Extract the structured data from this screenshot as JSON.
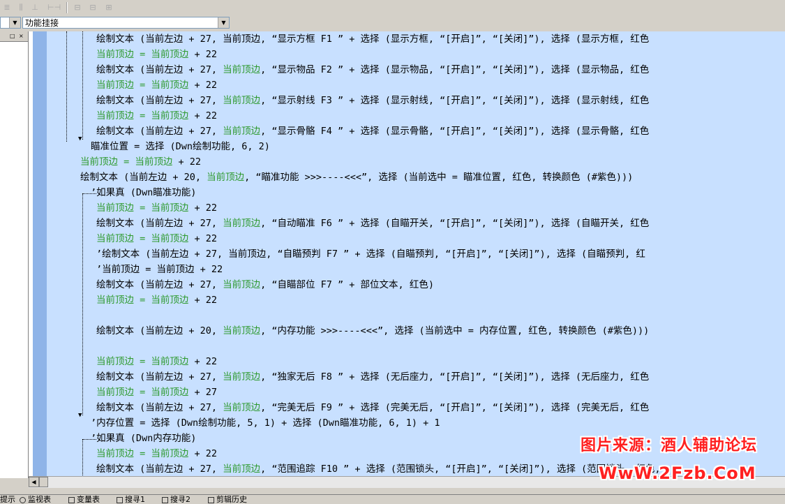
{
  "toolbar": {
    "buttons": [
      "align-top-icon",
      "align-vcenter-icon",
      "align-bottom-icon",
      "align-hspace-icon",
      "align-width-icon",
      "align-center-icon"
    ],
    "glyphs": [
      "≣",
      "⫼",
      "⊥",
      "⊢⊣",
      "⊟",
      "⊞"
    ]
  },
  "combos": {
    "left_value": "",
    "right_value": "功能挂接"
  },
  "left_panel": {
    "pin": "□",
    "close": "×"
  },
  "code_lines": [
    {
      "indent": 2,
      "segs": [
        [
          "绘制文本 (当前左边 + 27, ",
          ""
        ],
        [
          "当前顶边",
          ""
        ],
        [
          ", “显示方框 F1       ” + 选择 (显示方框, “[开启]”, “[关闭]”), 选择 (显示方框, 红色",
          ""
        ]
      ]
    },
    {
      "indent": 2,
      "segs": [
        [
          "当前顶边 = 当前顶边",
          "g"
        ],
        [
          " + 22",
          ""
        ]
      ]
    },
    {
      "indent": 2,
      "segs": [
        [
          "绘制文本 (当前左边 + 27, ",
          ""
        ],
        [
          "当前顶边",
          "g"
        ],
        [
          ", “显示物品 F2       ” + 选择 (显示物品, “[开启]”, “[关闭]”), 选择 (显示物品, 红色",
          ""
        ]
      ]
    },
    {
      "indent": 2,
      "segs": [
        [
          "当前顶边 = 当前顶边",
          "g"
        ],
        [
          " + 22",
          ""
        ]
      ]
    },
    {
      "indent": 2,
      "segs": [
        [
          "绘制文本 (当前左边 + 27, ",
          ""
        ],
        [
          "当前顶边",
          "g"
        ],
        [
          ", “显示射线 F3       ” + 选择 (显示射线, “[开启]”, “[关闭]”), 选择 (显示射线, 红色",
          ""
        ]
      ]
    },
    {
      "indent": 2,
      "segs": [
        [
          "当前顶边 = 当前顶边",
          "g"
        ],
        [
          " + 22",
          ""
        ]
      ]
    },
    {
      "indent": 2,
      "segs": [
        [
          "绘制文本 (当前左边 + 27, ",
          ""
        ],
        [
          "当前顶边",
          "g"
        ],
        [
          ", “显示骨骼 F4       ” + 选择 (显示骨骼, “[开启]”, “[关闭]”), 选择 (显示骨骼, 红色",
          ""
        ]
      ]
    },
    {
      "indent": 1,
      "segs": [
        [
          "瞄准位置 = 选择 (Dwn绘制功能, 6, 2)",
          ""
        ]
      ]
    },
    {
      "indent": 0,
      "segs": [
        [
          "当前顶边 = 当前顶边",
          "g"
        ],
        [
          " + 22",
          ""
        ]
      ]
    },
    {
      "indent": 0,
      "segs": [
        [
          "绘制文本 (当前左边 + 20, ",
          ""
        ],
        [
          "当前顶边",
          "g"
        ],
        [
          ", “瞄准功能 >>>----<<<”, 选择 (当前选中 = 瞄准位置, 红色, 转换颜色 (#紫色)))",
          ""
        ]
      ]
    },
    {
      "indent": 1,
      "segs": [
        [
          "’如果真 (Dwn瞄准功能)",
          ""
        ]
      ]
    },
    {
      "indent": 2,
      "segs": [
        [
          "当前顶边 = 当前顶边",
          "g"
        ],
        [
          " + 22",
          ""
        ]
      ]
    },
    {
      "indent": 2,
      "segs": [
        [
          "绘制文本 (当前左边 + 27, ",
          ""
        ],
        [
          "当前顶边",
          "g"
        ],
        [
          ", “自动瞄准 F6       ” + 选择 (自瞄开关, “[开启]”, “[关闭]”), 选择 (自瞄开关, 红色",
          ""
        ]
      ]
    },
    {
      "indent": 2,
      "segs": [
        [
          "当前顶边 = 当前顶边",
          "g"
        ],
        [
          " + 22",
          ""
        ]
      ]
    },
    {
      "indent": 2,
      "segs": [
        [
          "’绘制文本 (当前左边 + 27, 当前顶边, “自瞄预判 F7       ” + 选择 (自瞄预判, “[开启]”, “[关闭]”), 选择 (自瞄预判, 红",
          ""
        ]
      ]
    },
    {
      "indent": 2,
      "segs": [
        [
          "’当前顶边 = 当前顶边 + 22",
          ""
        ]
      ]
    },
    {
      "indent": 2,
      "segs": [
        [
          "绘制文本 (当前左边 + 27, ",
          ""
        ],
        [
          "当前顶边",
          "g"
        ],
        [
          ", “自瞄部位 F7       ” + 部位文本, 红色)",
          ""
        ]
      ]
    },
    {
      "indent": 2,
      "segs": [
        [
          "当前顶边 = 当前顶边",
          "g"
        ],
        [
          " + 22",
          ""
        ]
      ]
    },
    {
      "indent": 2,
      "segs": [
        [
          "",
          ""
        ]
      ]
    },
    {
      "indent": 2,
      "segs": [
        [
          "绘制文本 (当前左边 + 20, ",
          ""
        ],
        [
          "当前顶边",
          "g"
        ],
        [
          ", “内存功能 >>>----<<<”, 选择 (当前选中 = 内存位置, 红色, 转换颜色 (#紫色)))",
          ""
        ]
      ]
    },
    {
      "indent": 2,
      "segs": [
        [
          "",
          ""
        ]
      ]
    },
    {
      "indent": 2,
      "segs": [
        [
          "当前顶边 = 当前顶边",
          "g"
        ],
        [
          " + 22",
          ""
        ]
      ]
    },
    {
      "indent": 2,
      "segs": [
        [
          "绘制文本 (当前左边 + 27, ",
          ""
        ],
        [
          "当前顶边",
          "g"
        ],
        [
          ", “独家无后 F8       ” + 选择 (无后座力, “[开启]”, “[关闭]”), 选择 (无后座力, 红色",
          ""
        ]
      ]
    },
    {
      "indent": 2,
      "segs": [
        [
          "当前顶边 = 当前顶边",
          "g"
        ],
        [
          " + 27",
          ""
        ]
      ]
    },
    {
      "indent": 2,
      "segs": [
        [
          "绘制文本 (当前左边 + 27, ",
          ""
        ],
        [
          "当前顶边",
          "g"
        ],
        [
          ", “完美无后 F9       ” + 选择 (完美无后, “[开启]”, “[关闭]”), 选择 (完美无后, 红色",
          ""
        ]
      ]
    },
    {
      "indent": 1,
      "segs": [
        [
          "’内存位置 = 选择 (Dwn绘制功能, 5, 1) + 选择 (Dwn瞄准功能, 6, 1) + 1",
          ""
        ]
      ]
    },
    {
      "indent": 1,
      "segs": [
        [
          "’如果真 (Dwn内存功能)",
          ""
        ]
      ]
    },
    {
      "indent": 2,
      "segs": [
        [
          "当前顶边 = 当前顶边",
          "g"
        ],
        [
          " + 22",
          ""
        ]
      ]
    },
    {
      "indent": 2,
      "segs": [
        [
          "绘制文本 (当前左边 + 27, ",
          ""
        ],
        [
          "当前顶边",
          "g"
        ],
        [
          ", “范围追踪 F10     ” + 选择 (范围锁头, “[开启]”, “[关闭]”), 选择 (范围锁头, 红色,",
          ""
        ]
      ]
    }
  ],
  "bottom_tabs": [
    "提示",
    "监视表",
    "变量表",
    "搜寻1",
    "搜寻2",
    "剪辑历史"
  ],
  "watermark": {
    "line1": "图片来源：酒人辅助论坛",
    "line2": "WwW.2Fzb.CoM"
  }
}
